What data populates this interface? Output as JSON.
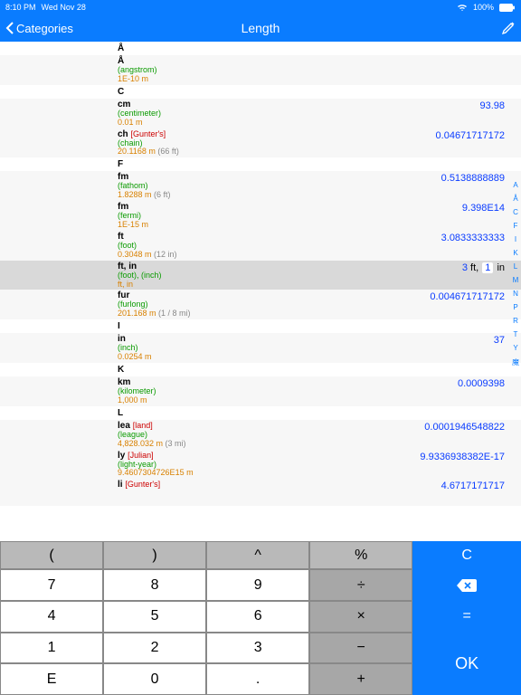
{
  "status": {
    "time": "8:10 PM",
    "date": "Wed Nov 28",
    "wifi": "wifi-icon",
    "battery_pct": "100%"
  },
  "header": {
    "back": "Categories",
    "title": "Length"
  },
  "index": [
    "A",
    "Å",
    "C",
    "F",
    "I",
    "K",
    "L",
    "M",
    "N",
    "P",
    "R",
    "T",
    "Y",
    "魔"
  ],
  "sections": [
    {
      "letter": "Å",
      "rows": [
        {
          "sym": "Å",
          "name": "(angstrom)",
          "def": "1E-10 m",
          "val": ""
        }
      ]
    },
    {
      "letter": "C",
      "rows": [
        {
          "sym": "cm",
          "name": "(centimeter)",
          "def": "0.01 m",
          "val": "93.98"
        },
        {
          "sym": "ch",
          "qual": "[Gunter's]",
          "name": "(chain)",
          "def": "20.1168 m",
          "suffix": "(66 ft)",
          "val": "0.04671717172"
        }
      ]
    },
    {
      "letter": "F",
      "rows": [
        {
          "sym": "fm",
          "name": "(fathom)",
          "def": "1.8288 m",
          "suffix": "(6 ft)",
          "val": "0.5138888889"
        },
        {
          "sym": "fm",
          "name": "(fermi)",
          "def": "1E-15 m",
          "val": "9.398E14"
        },
        {
          "sym": "ft",
          "name": "(foot)",
          "def": "0.3048 m",
          "suffix": "(12 in)",
          "val": "3.0833333333"
        },
        {
          "sym": "ft, in",
          "name": "(foot),  (inch)",
          "def": "ft, in",
          "val_ftin": {
            "ft": "3",
            "in": "1"
          },
          "selected": true
        },
        {
          "sym": "fur",
          "name": "(furlong)",
          "def": "201.168 m",
          "suffix": "(1 / 8 mi)",
          "val": "0.004671717172"
        }
      ]
    },
    {
      "letter": "I",
      "rows": [
        {
          "sym": "in",
          "name": "(inch)",
          "def": "0.0254 m",
          "val": "37"
        }
      ]
    },
    {
      "letter": "K",
      "rows": [
        {
          "sym": "km",
          "name": "(kilometer)",
          "def": "1,000 m",
          "val": "0.0009398"
        }
      ]
    },
    {
      "letter": "L",
      "rows": [
        {
          "sym": "lea",
          "qual": "[land]",
          "name": "(league)",
          "def": "4,828.032 m",
          "suffix": "(3 mi)",
          "val": "0.0001946548822"
        },
        {
          "sym": "ly",
          "qual": "[Julian]",
          "name": "(light-year)",
          "def": "9.4607304726E15 m",
          "val": "9.9336938382E-17"
        },
        {
          "sym": "li",
          "qual": "[Gunter's]",
          "name": "",
          "def": "",
          "val": "4.6717171717"
        }
      ]
    }
  ],
  "keypad": {
    "r0": [
      "(",
      ")",
      "^",
      "%",
      "C"
    ],
    "r1": [
      "7",
      "8",
      "9",
      "÷",
      "⌫"
    ],
    "r2": [
      "4",
      "5",
      "6",
      "×",
      "="
    ],
    "r3": [
      "1",
      "2",
      "3",
      "−",
      "OK"
    ],
    "r4": [
      "E",
      "0",
      ".",
      "+"
    ]
  }
}
